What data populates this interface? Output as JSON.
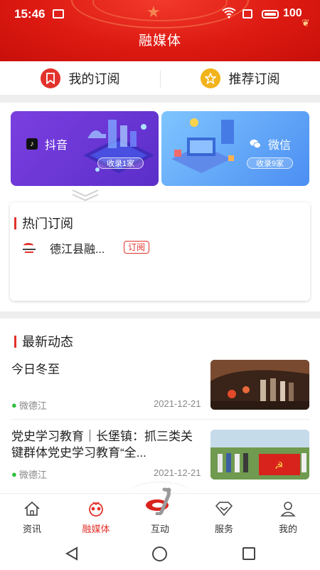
{
  "status_bar": {
    "time": "15:46",
    "battery": "100"
  },
  "header": {
    "title": "融媒体"
  },
  "sub_tabs": [
    {
      "label": "我的订阅",
      "icon": "bookmark-icon"
    },
    {
      "label": "推荐订阅",
      "icon": "star-icon"
    }
  ],
  "platform_cards": [
    {
      "name": "抖音",
      "count": "收录1家",
      "icon": "tiktok-icon"
    },
    {
      "name": "微信",
      "count": "收录9家",
      "icon": "wechat-icon"
    }
  ],
  "hot": {
    "title": "热门订阅",
    "items": [
      {
        "label": "德江县融...",
        "button": "订阅"
      }
    ]
  },
  "news": {
    "title": "最新动态",
    "items": [
      {
        "headline": "今日冬至",
        "source": "微德江",
        "date": "2021-12-21"
      },
      {
        "headline": "党史学习教育｜长堡镇：抓三类关键群体党史学习教育“全...",
        "source": "微德江",
        "date": "2021-12-21"
      }
    ]
  },
  "bottom_nav": [
    {
      "label": "资讯",
      "icon": "home-icon"
    },
    {
      "label": "融媒体",
      "icon": "media-icon",
      "active": true
    },
    {
      "label": "互动",
      "icon": "interact-logo-icon"
    },
    {
      "label": "服务",
      "icon": "service-icon"
    },
    {
      "label": "我的",
      "icon": "profile-icon"
    }
  ],
  "colors": {
    "accent": "#e2322b",
    "header": "#dd1a12"
  }
}
